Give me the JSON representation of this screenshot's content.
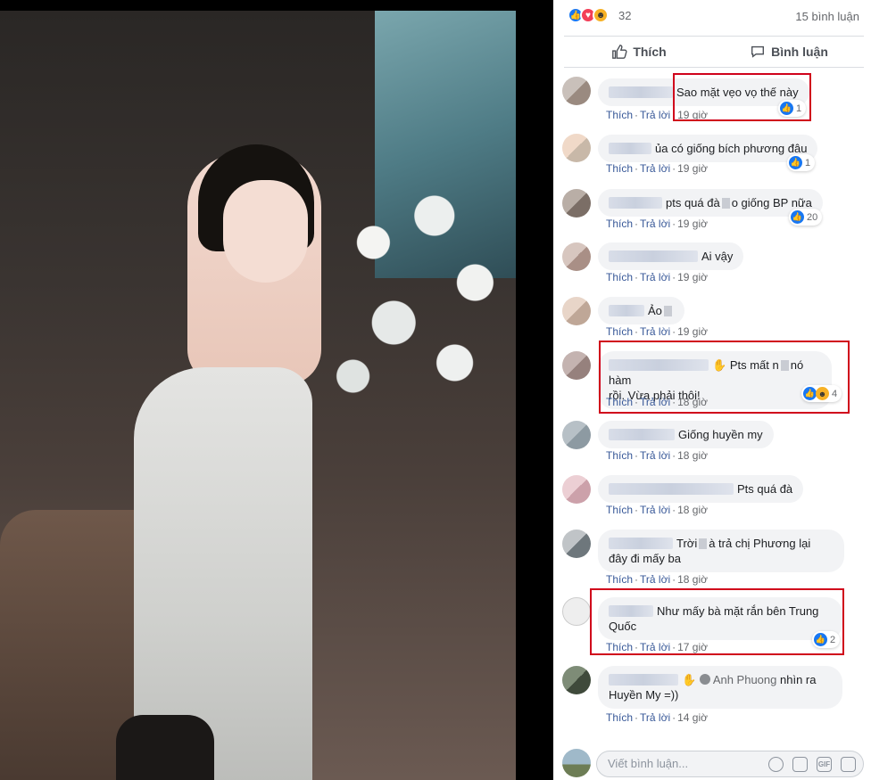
{
  "post": {
    "reaction_count": "32",
    "comment_count": "15 bình luận",
    "like_label": "Thích",
    "comment_label": "Bình luận"
  },
  "comments": [
    {
      "text": "Sao mặt vẹo vọ thế này",
      "like": "Thích",
      "reply": "Trả lời",
      "time": "19 giờ",
      "reactions": "1"
    },
    {
      "text": "ủa có giống bích phương đâu",
      "like": "Thích",
      "reply": "Trả lời",
      "time": "19 giờ",
      "reactions": "1"
    },
    {
      "text_a": "pts quá đà",
      "text_b": "o giống BP nữa",
      "like": "Thích",
      "reply": "Trả lời",
      "time": "19 giờ",
      "reactions": "20"
    },
    {
      "text": "Ai vậy",
      "like": "Thích",
      "reply": "Trả lời",
      "time": "19 giờ"
    },
    {
      "text": "Ảo",
      "like": "Thích",
      "reply": "Trả lời",
      "time": "19 giờ"
    },
    {
      "text_a": "Pts mất n",
      "text_b": "nó hàm",
      "text_c": "rồi. Vừa phải thôi!",
      "like": "Thích",
      "reply": "Trả lời",
      "time": "18 giờ",
      "reactions": "4"
    },
    {
      "text": "Giống huyền my",
      "like": "Thích",
      "reply": "Trả lời",
      "time": "18 giờ"
    },
    {
      "text": "Pts quá đà",
      "like": "Thích",
      "reply": "Trả lời",
      "time": "18 giờ"
    },
    {
      "text_a": "Trời",
      "text_b": "à trả chị Phương lại",
      "text_c": "đây đi mấy ba",
      "like": "Thích",
      "reply": "Trả lời",
      "time": "18 giờ"
    },
    {
      "text_a": "Như mấy bà mặt rắn bên Trung",
      "text_b": "Quốc",
      "like": "Thích",
      "reply": "Trả lời",
      "time": "17 giờ",
      "reactions": "2"
    },
    {
      "mention": "Anh Phuong",
      "text_a": "nhìn ra",
      "text_b": "Huyền My =))",
      "like": "Thích",
      "reply": "Trả lời",
      "time": "14 giờ"
    }
  ],
  "compose": {
    "placeholder": "Viết bình luận..."
  },
  "icons": [
    "like-icon",
    "love-icon",
    "haha-icon",
    "thumb-up-icon",
    "speech-bubble-icon",
    "emoji-icon",
    "camera-icon",
    "gif-icon",
    "sticker-icon"
  ],
  "colors": {
    "like_blue": "#1877f2",
    "link_blue": "#385898",
    "highlight_red": "#d0021b"
  }
}
